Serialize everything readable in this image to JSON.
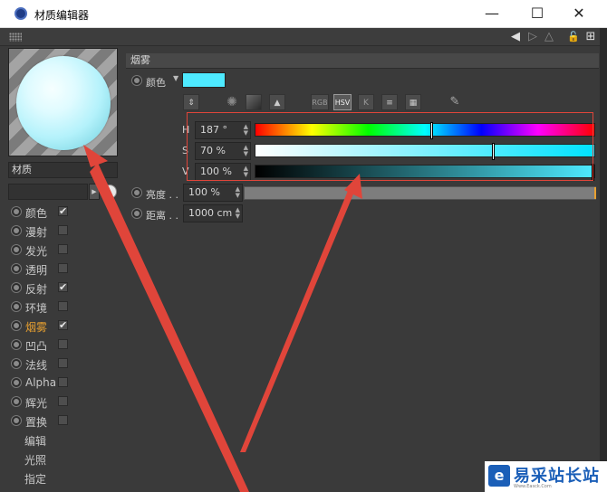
{
  "window": {
    "title": "材质编辑器",
    "minimize": "—",
    "maximize": "☐",
    "close": "✕"
  },
  "toolbar": {
    "back_icon": "◀",
    "forward_icon": "▷",
    "up_icon": "△",
    "lock_icon": "🔓",
    "add_icon": "⊞"
  },
  "material": {
    "name_label": "材质"
  },
  "channels": [
    {
      "label": "颜色",
      "checked": "✔",
      "active": false
    },
    {
      "label": "漫射",
      "checked": "",
      "active": false
    },
    {
      "label": "发光",
      "checked": "",
      "active": false
    },
    {
      "label": "透明",
      "checked": "",
      "active": false
    },
    {
      "label": "反射",
      "checked": "✔",
      "active": false
    },
    {
      "label": "环境",
      "checked": "",
      "active": false
    },
    {
      "label": "烟雾",
      "checked": "✔",
      "active": true
    },
    {
      "label": "凹凸",
      "checked": "",
      "active": false
    },
    {
      "label": "法线",
      "checked": "",
      "active": false
    },
    {
      "label": "Alpha",
      "checked": "",
      "active": false
    },
    {
      "label": "辉光",
      "checked": "",
      "active": false
    },
    {
      "label": "置换",
      "checked": "",
      "active": false
    }
  ],
  "extra_items": [
    "编辑",
    "光照",
    "指定"
  ],
  "fog": {
    "section_title": "烟雾",
    "color_label": "颜色",
    "color_hex": "#4eeaff",
    "modes": [
      "RGB",
      "HSV",
      "K"
    ],
    "h_label": "H",
    "h_value": "187 °",
    "h_fraction": 0.52,
    "s_label": "S",
    "s_value": "70 %",
    "s_fraction": 0.7,
    "v_label": "V",
    "v_value": "100 %",
    "v_fraction": 1.0,
    "brightness_label": "亮度 . .",
    "brightness_value": "100 %",
    "distance_label": "距离 . .",
    "distance_value": "1000 cm"
  },
  "watermark": {
    "logo": "e",
    "text": "易采站长站",
    "sub": "Www.Easck.Com"
  },
  "accent_colors": {
    "active_channel": "#e8a030",
    "annotation": "#e0453a"
  }
}
